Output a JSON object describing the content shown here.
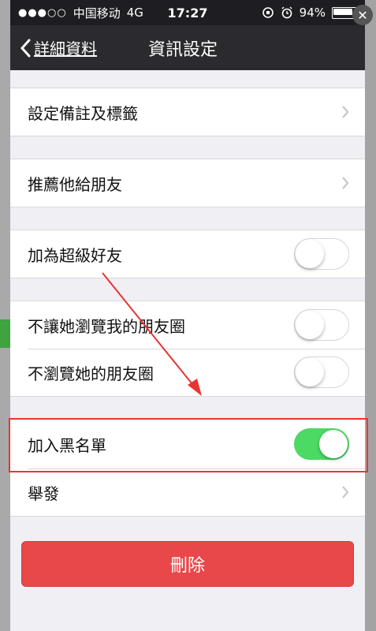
{
  "status_bar": {
    "signal": "●●●○○",
    "carrier": "中国移动",
    "network": "4G",
    "time": "17:27",
    "battery": "94%"
  },
  "nav": {
    "back_label": "詳細資料",
    "title": "資訊設定"
  },
  "rows": {
    "remark": "設定備註及標籤",
    "recommend": "推薦他給朋友",
    "super_friend": "加為超級好友",
    "hide_moments": "不讓她瀏覽我的朋友圈",
    "no_view_moments": "不瀏覽她的朋友圈",
    "blacklist": "加入黑名單",
    "report": "舉發"
  },
  "toggles": {
    "super_friend": false,
    "hide_moments": false,
    "no_view_moments": false,
    "blacklist": true
  },
  "delete_label": "刪除",
  "colors": {
    "toggle_on": "#4cd964",
    "delete_button": "#e9484a",
    "annotation": "#e83434"
  }
}
